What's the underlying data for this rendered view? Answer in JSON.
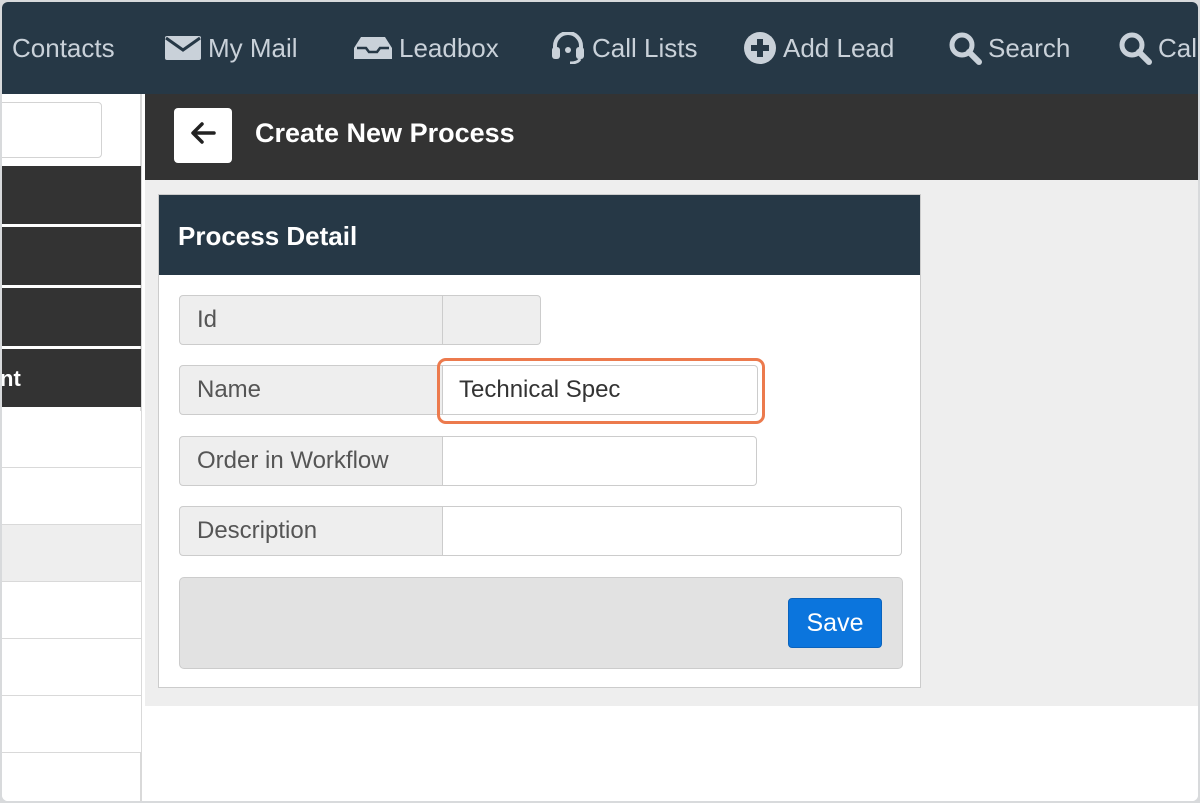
{
  "nav": {
    "items": [
      {
        "label": "Contacts",
        "icon": "contacts-icon"
      },
      {
        "label": "My Mail",
        "icon": "envelope-icon"
      },
      {
        "label": "Leadbox",
        "icon": "inbox-tray-icon"
      },
      {
        "label": "Call Lists",
        "icon": "headset-icon"
      },
      {
        "label": "Add Lead",
        "icon": "plus-circle-icon"
      },
      {
        "label": "Search",
        "icon": "search-icon"
      },
      {
        "label": "Cal",
        "icon": "search-icon"
      }
    ]
  },
  "sidebar": {
    "partial_label": "nt"
  },
  "header": {
    "title": "Create New Process"
  },
  "panel": {
    "title": "Process Detail",
    "fields": {
      "id": {
        "label": "Id",
        "value": ""
      },
      "name": {
        "label": "Name",
        "value": "Technical Spec"
      },
      "order": {
        "label": "Order in Workflow",
        "value": ""
      },
      "description": {
        "label": "Description",
        "value": ""
      }
    },
    "save_label": "Save"
  },
  "colors": {
    "nav_bg": "#263846",
    "header_bg": "#333333",
    "accent": "#0b75dd",
    "focus_highlight": "#ec7a4d"
  }
}
